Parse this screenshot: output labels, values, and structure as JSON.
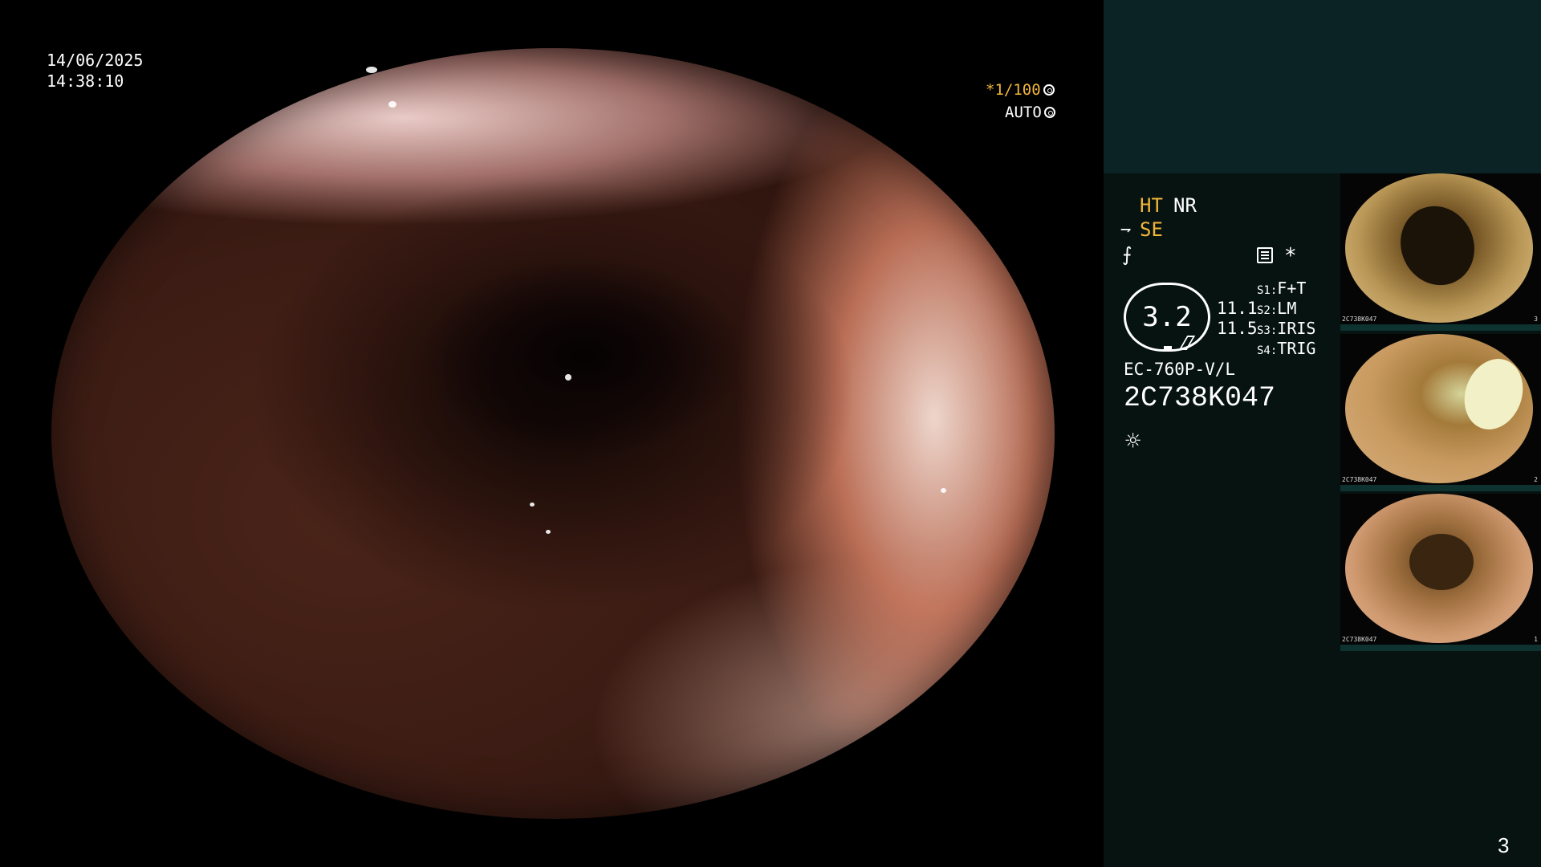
{
  "overlay": {
    "date": "14/06/2025",
    "time": "14:38:10",
    "shutter_speed": "*1/100",
    "exposure_mode": "AUTO"
  },
  "panel": {
    "mode_ht": "HT",
    "mode_nr": "NR",
    "mode_se": "SE",
    "star": "*",
    "gauge_value": "3.2",
    "value_1": "11.1",
    "value_2": "11.5",
    "settings": [
      {
        "label": "S1:",
        "value": "F+T"
      },
      {
        "label": "S2:",
        "value": "LM"
      },
      {
        "label": "S3:",
        "value": "IRIS"
      },
      {
        "label": "S4:",
        "value": "TRIG"
      }
    ],
    "scope_model": "EC-760P-V/L",
    "scope_serial": "2C738K047"
  },
  "thumbnails": [
    {
      "serial": "2C738K047",
      "index": "3"
    },
    {
      "serial": "2C738K047",
      "index": "2"
    },
    {
      "serial": "2C738K047",
      "index": "1"
    }
  ],
  "page_number": "3",
  "colors": {
    "accent_orange": "#f2b53a",
    "panel_top": "#0c2325",
    "panel_bottom": "#061311"
  }
}
